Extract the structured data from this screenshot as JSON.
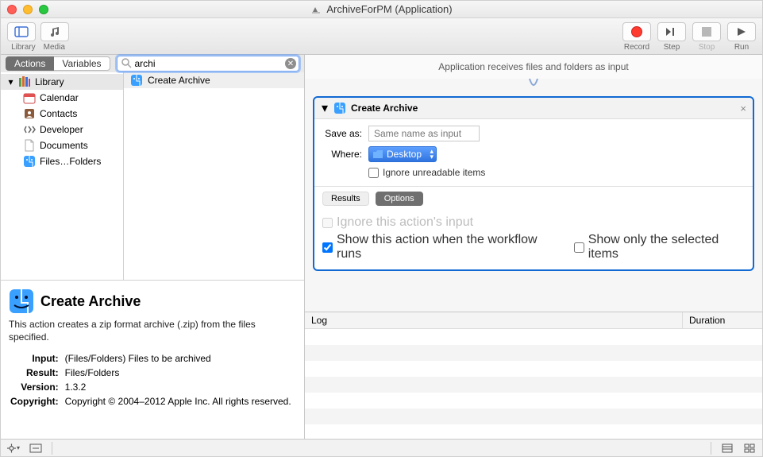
{
  "window": {
    "title": "ArchiveForPM (Application)"
  },
  "toolbar": {
    "left": [
      {
        "id": "library",
        "label": "Library"
      },
      {
        "id": "media",
        "label": "Media"
      }
    ],
    "right": [
      {
        "id": "record",
        "label": "Record"
      },
      {
        "id": "step",
        "label": "Step"
      },
      {
        "id": "stop",
        "label": "Stop",
        "disabled": true
      },
      {
        "id": "run",
        "label": "Run"
      }
    ]
  },
  "tabs": {
    "actions": "Actions",
    "variables": "Variables"
  },
  "search": {
    "value": "archi",
    "placeholder": "Search"
  },
  "library": {
    "root": "Library",
    "items": [
      {
        "label": "Calendar"
      },
      {
        "label": "Contacts"
      },
      {
        "label": "Developer"
      },
      {
        "label": "Documents"
      },
      {
        "label": "Files…Folders",
        "truncatedFrom": "Files & Folders"
      }
    ]
  },
  "results": {
    "items": [
      "Create Archive"
    ]
  },
  "details": {
    "title": "Create Archive",
    "desc": "This action creates a zip format archive (.zip) from the files specified.",
    "rows": {
      "input_k": "Input:",
      "input_v": "(Files/Folders) Files to be archived",
      "result_k": "Result:",
      "result_v": "Files/Folders",
      "version_k": "Version:",
      "version_v": "1.3.2",
      "copyright_k": "Copyright:",
      "copyright_v": "Copyright © 2004–2012 Apple Inc.  All rights reserved."
    }
  },
  "workflow": {
    "header": "Application receives files and folders as input",
    "action": {
      "title": "Create Archive",
      "saveas_label": "Save as:",
      "saveas_placeholder": "Same name as input",
      "where_label": "Where:",
      "where_value": "Desktop",
      "ignore_unreadable": "Ignore unreadable items",
      "results_label": "Results",
      "options_label": "Options",
      "ignore_input": "Ignore this action's input",
      "show_workflow_runs": "Show this action when the workflow runs",
      "show_workflow_runs_checked": true,
      "show_selected": "Show only the selected items"
    }
  },
  "log": {
    "col_log": "Log",
    "col_duration": "Duration"
  },
  "status": {
    "gear": "Settings",
    "view": "View"
  },
  "colors": {
    "accent": "#1169d2"
  }
}
